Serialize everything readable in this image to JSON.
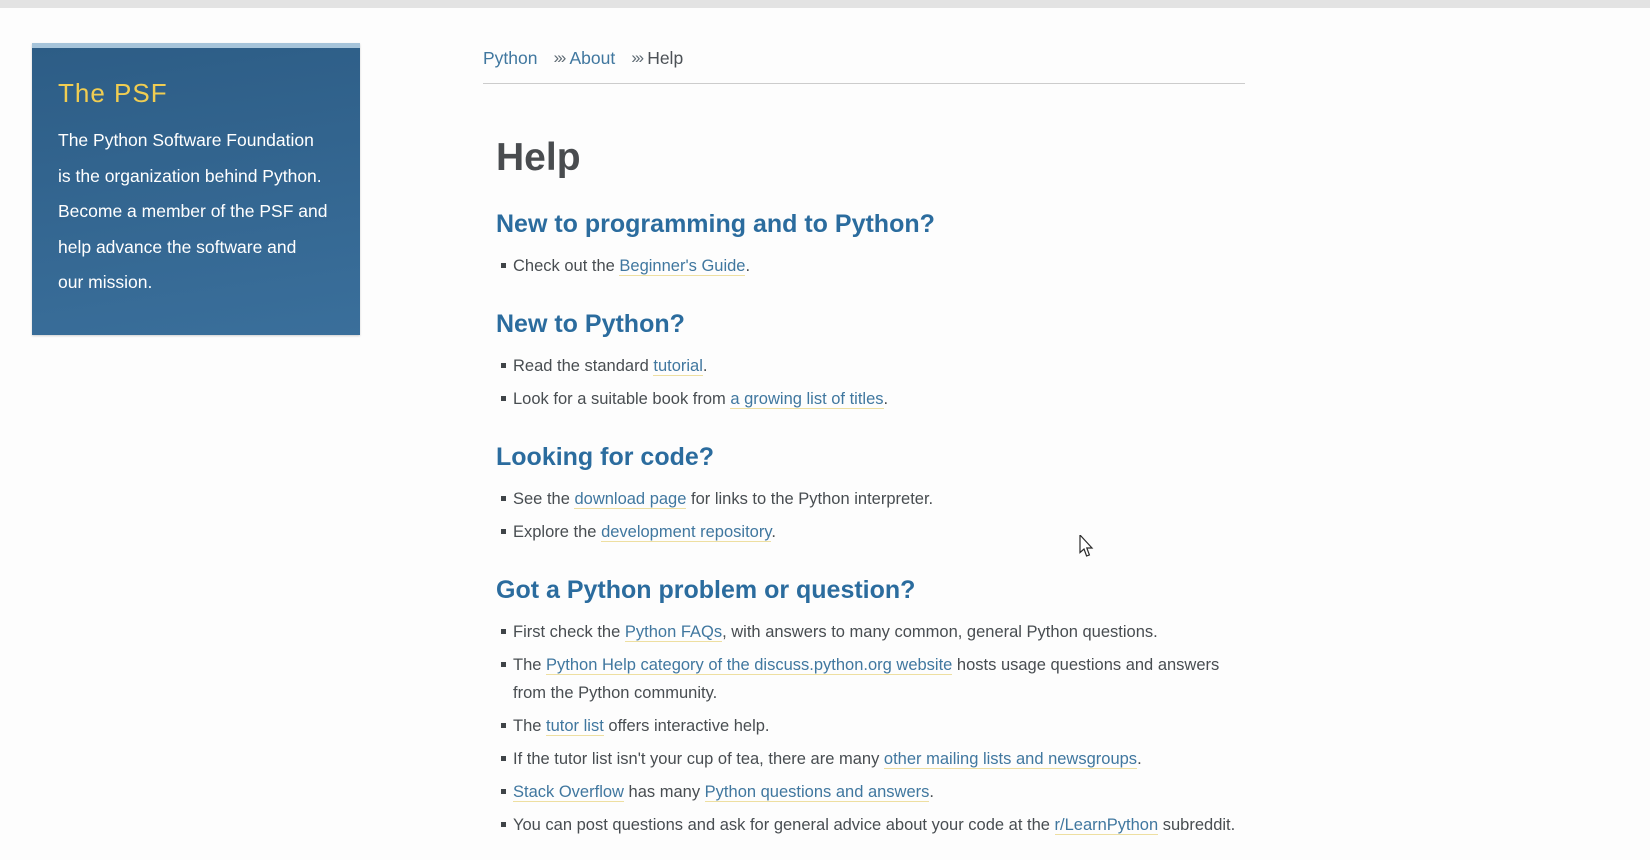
{
  "browser": {
    "top_strip_color": "#e3e3e3"
  },
  "psf_widget": {
    "title": "The PSF",
    "body_lines": [
      "The Python Software Foundation",
      "is the organization behind Python.",
      "Become a member of the PSF and",
      "help advance the software and",
      "our mission."
    ]
  },
  "breadcrumb": {
    "separator": "›››",
    "items": [
      {
        "id": "python",
        "label": "Python",
        "type": "link"
      },
      {
        "id": "about",
        "label": "About",
        "type": "link"
      },
      {
        "id": "help",
        "label": "Help",
        "type": "current"
      }
    ]
  },
  "page": {
    "title": "Help"
  },
  "sections": [
    {
      "heading": "New to programming and to Python?",
      "items": [
        [
          {
            "text": "Check out the "
          },
          {
            "link": "Beginner's Guide"
          },
          {
            "text": "."
          }
        ]
      ]
    },
    {
      "heading": "New to Python?",
      "items": [
        [
          {
            "text": "Read the standard "
          },
          {
            "link": "tutorial"
          },
          {
            "text": "."
          }
        ],
        [
          {
            "text": "Look for a suitable book from "
          },
          {
            "link": "a growing list of titles"
          },
          {
            "text": "."
          }
        ]
      ]
    },
    {
      "heading": "Looking for code?",
      "items": [
        [
          {
            "text": "See the "
          },
          {
            "link": "download page"
          },
          {
            "text": " for links to the Python interpreter."
          }
        ],
        [
          {
            "text": "Explore the "
          },
          {
            "link": "development repository"
          },
          {
            "text": "."
          }
        ]
      ]
    },
    {
      "heading": "Got a Python problem or question?",
      "items": [
        [
          {
            "text": "First check the "
          },
          {
            "link": "Python FAQs"
          },
          {
            "text": ", with answers to many common, general Python questions."
          }
        ],
        [
          {
            "text": "The "
          },
          {
            "link": "Python Help category of the discuss.python.org website"
          },
          {
            "text": " hosts usage questions and answers from the Python community."
          }
        ],
        [
          {
            "text": "The "
          },
          {
            "link": "tutor list"
          },
          {
            "text": " offers interactive help."
          }
        ],
        [
          {
            "text": "If the tutor list isn't your cup of tea, there are many "
          },
          {
            "link": "other mailing lists and newsgroups"
          },
          {
            "text": "."
          }
        ],
        [
          {
            "link": "Stack Overflow"
          },
          {
            "text": " has many "
          },
          {
            "link": "Python questions and answers"
          },
          {
            "text": "."
          }
        ],
        [
          {
            "text": "You can post questions and ask for general advice about your code at the "
          },
          {
            "link": "r/LearnPython"
          },
          {
            "text": " subreddit."
          }
        ]
      ]
    }
  ],
  "colors": {
    "strip": "#e3e3e3",
    "heading": "#494c4f",
    "section_heading": "#2b6c9e",
    "body_text": "#484d51",
    "link": "#40779f",
    "link_underline": "#eedfa1",
    "rule": "#cccccc",
    "psf_bg_top": "#2d5d86",
    "psf_bg_bottom": "#3a6f9b",
    "psf_border": "#a6c4da",
    "psf_title": "#f0cd52",
    "psf_text": "#ffffff"
  }
}
